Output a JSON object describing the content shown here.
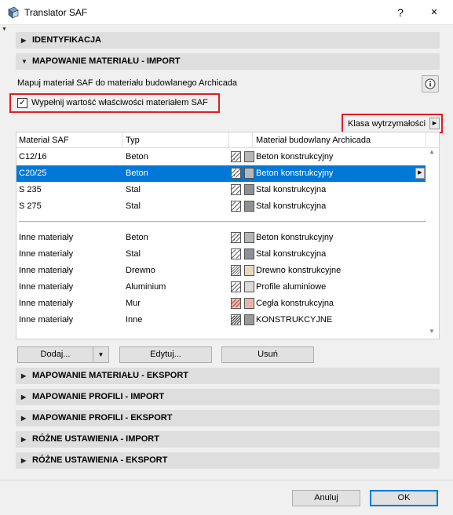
{
  "window": {
    "title": "Translator SAF",
    "help_label": "?",
    "close_glyph": "✕",
    "corner_glyph": "▼"
  },
  "sections": {
    "identifikacja": "IDENTYFIKACJA",
    "material_import": "MAPOWANIE MATERIAŁU - IMPORT",
    "material_export": "MAPOWANIE MATERIAŁU - EKSPORT",
    "profile_import": "MAPOWANIE PROFILI - IMPORT",
    "profile_export": "MAPOWANIE PROFILI - EKSPORT",
    "misc_import": "RÓŻNE USTAWIENIA - IMPORT",
    "misc_export": "RÓŻNE USTAWIENIA - EKSPORT",
    "arrow_collapsed": "▶",
    "arrow_expanded": "▼"
  },
  "material_import": {
    "description": "Mapuj materiał SAF do materiału budowlanego Archicada",
    "checkbox_label": "Wypełnij wartość właściwości materiałem SAF",
    "checkbox_checked": true,
    "checkbox_mark": "✓",
    "class_button": "Klasa wytrzymałości",
    "class_button_arrow": "▶"
  },
  "table": {
    "columns": [
      "Materiał SAF",
      "Typ",
      "Materiał budowlany Archicada"
    ],
    "scroll_up": "▲",
    "scroll_down": "▼",
    "row_arrow": "▶",
    "rows": [
      {
        "saf": "C12/16",
        "type": "Beton",
        "building": "Beton konstrukcyjny",
        "color": "#b7b7b7",
        "pattern": "beton"
      },
      {
        "saf": "C20/25",
        "type": "Beton",
        "building": "Beton konstrukcyjny",
        "color": "#b7b7b7",
        "pattern": "beton",
        "selected": true
      },
      {
        "saf": "S 235",
        "type": "Stal",
        "building": "Stal konstrukcyjna",
        "color": "#8d9195",
        "pattern": "stal"
      },
      {
        "saf": "S 275",
        "type": "Stal",
        "building": "Stal konstrukcyjna",
        "color": "#8d9195",
        "pattern": "stal"
      },
      {
        "saf": "Inne materiały",
        "type": "Beton",
        "building": "Beton konstrukcyjny",
        "color": "#b7b7b7",
        "pattern": "beton"
      },
      {
        "saf": "Inne materiały",
        "type": "Stal",
        "building": "Stal konstrukcyjna",
        "color": "#8d9195",
        "pattern": "stal"
      },
      {
        "saf": "Inne materiały",
        "type": "Drewno",
        "building": "Drewno konstrukcyjne",
        "color": "#e8d8c0",
        "pattern": "drewno"
      },
      {
        "saf": "Inne materiały",
        "type": "Aluminium",
        "building": "Profile aluminiowe",
        "color": "#dcdcdc",
        "pattern": "aluminium"
      },
      {
        "saf": "Inne materiały",
        "type": "Mur",
        "building": "Cegła konstrukcyjna",
        "color": "#e8b5a8",
        "pattern": "mur"
      },
      {
        "saf": "Inne materiały",
        "type": "Inne",
        "building": "KONSTRUKCYJNE",
        "color": "#999999",
        "pattern": "inne"
      }
    ]
  },
  "buttons": {
    "add": "Dodaj...",
    "add_arrow": "▼",
    "edit": "Edytuj...",
    "delete": "Usuń",
    "cancel": "Anuluj",
    "ok": "OK"
  }
}
